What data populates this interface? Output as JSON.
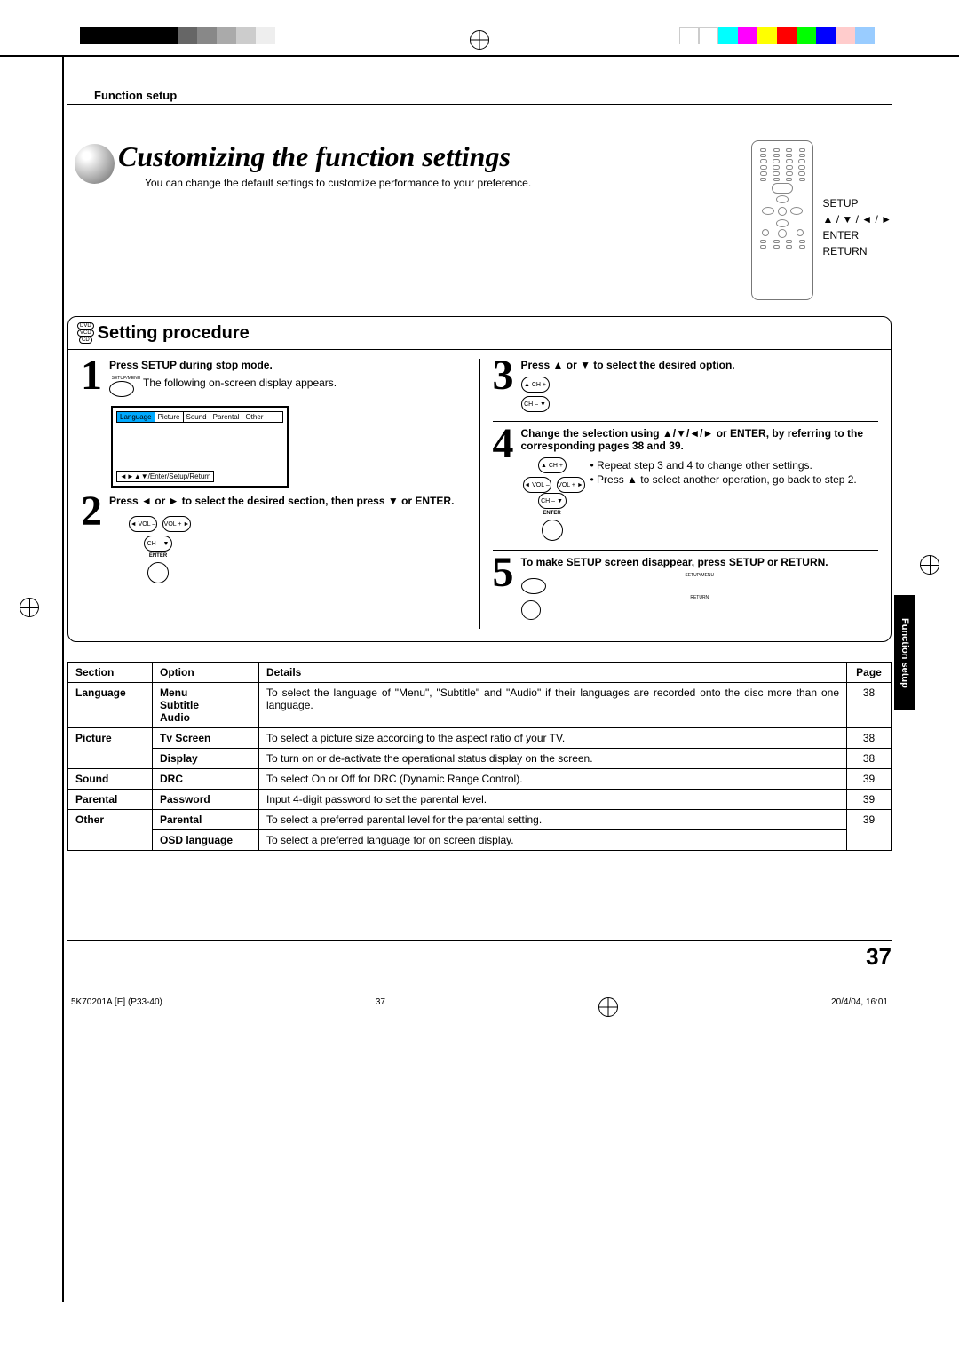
{
  "header": {
    "section_label": "Function setup"
  },
  "title": {
    "main": "Customizing the function settings",
    "sub": "You can change the default settings to customize performance to your preference."
  },
  "remote_labels": {
    "setup": "SETUP",
    "nav": "▲ / ▼ / ◄ / ►",
    "enter": "ENTER",
    "return": "RETURN"
  },
  "discs": {
    "dvd": "DVD",
    "vcd": "VCD",
    "cd": "CD"
  },
  "procedure_title": "Setting procedure",
  "steps": {
    "s1": {
      "title": "Press SETUP during stop mode.",
      "body": "The following on-screen display appears.",
      "btn": "SETUP/MENU",
      "osd_tabs": {
        "language": "Language",
        "picture": "Picture",
        "sound": "Sound",
        "parental": "Parental",
        "other": "Other"
      },
      "osd_bottom": "◄►▲▼/Enter/Setup/Return"
    },
    "s2": {
      "title_pre": "Press ◄ or ► to select the desired section, then press ▼ or ENTER.",
      "vol_minus": "◄ VOL –",
      "vol_plus": "VOL + ►",
      "ch_minus": "CH – ▼",
      "enter": "ENTER"
    },
    "s3": {
      "title": "Press ▲ or ▼ to select the desired option.",
      "ch_plus": "▲ CH +",
      "ch_minus": "CH – ▼"
    },
    "s4": {
      "title": "Change the selection using ▲/▼/◄/► or ENTER, by referring to the corresponding pages 38 and 39.",
      "bullet1": "Repeat step 3 and 4 to change other settings.",
      "bullet2": "Press ▲ to select another operation, go back to step 2.",
      "ch_plus": "▲ CH +",
      "vol_minus": "◄ VOL –",
      "vol_plus": "VOL + ►",
      "ch_minus": "CH – ▼",
      "enter": "ENTER"
    },
    "s5": {
      "title": "To make SETUP screen disappear, press SETUP or RETURN.",
      "setup": "SETUP/MENU",
      "return": "RETURN"
    }
  },
  "thumb_tab": "Function setup",
  "table": {
    "headers": {
      "section": "Section",
      "option": "Option",
      "details": "Details",
      "page": "Page"
    },
    "rows": [
      {
        "section": "Language",
        "option": "Menu\nSubtitle\nAudio",
        "details": "To select the language of \"Menu\", \"Subtitle\" and \"Audio\" if their languages are recorded onto the disc more than one language.",
        "page": "38"
      },
      {
        "section": "Picture",
        "option": "Tv Screen",
        "details": "To select a picture size according to the aspect ratio of your TV.",
        "page": "38"
      },
      {
        "section": "Picture",
        "option": "Display",
        "details": "To turn on or de-activate the operational status display on the screen.",
        "page": "38"
      },
      {
        "section": "Sound",
        "option": "DRC",
        "details": "To select On or Off for DRC (Dynamic Range Control).",
        "page": "39"
      },
      {
        "section": "Parental",
        "option": "Password",
        "details": "Input 4-digit password to set the parental level.",
        "page": "39"
      },
      {
        "section": "Other",
        "option": "Parental",
        "details": "To select a preferred parental level for the parental setting.",
        "page": "39"
      },
      {
        "section": "Other",
        "option": "OSD language",
        "details": "To select a preferred language for on screen display.",
        "page": "39"
      }
    ]
  },
  "page_number": "37",
  "footer": {
    "doc": "5K70201A [E] (P33-40)",
    "page": "37",
    "date": "20/4/04, 16:01"
  }
}
